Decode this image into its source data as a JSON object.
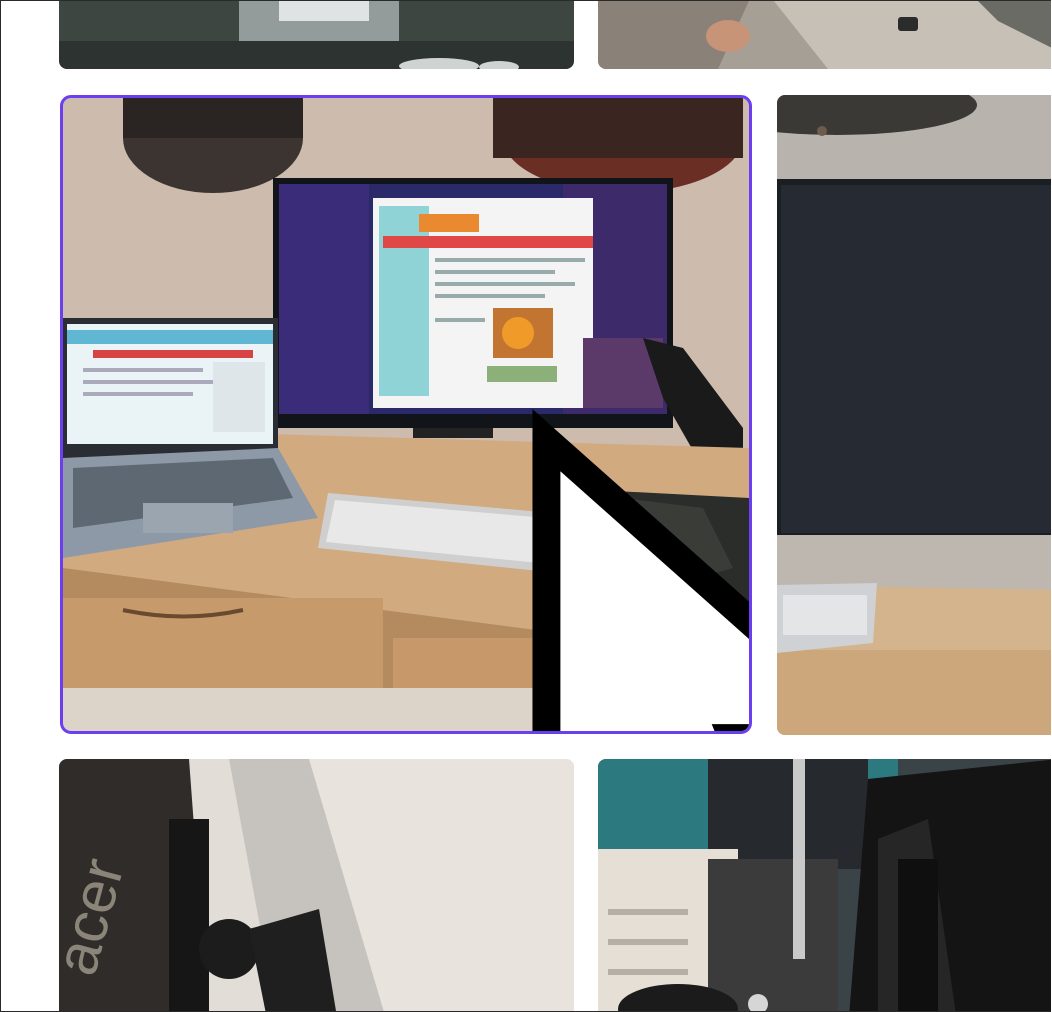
{
  "gallery": {
    "selected_index": 2,
    "items": [
      {
        "id": "photo-1",
        "icon": "photo-thumbnail"
      },
      {
        "id": "photo-2",
        "icon": "photo-thumbnail"
      },
      {
        "id": "photo-3",
        "icon": "photo-thumbnail",
        "selected": true
      },
      {
        "id": "photo-4",
        "icon": "photo-thumbnail"
      },
      {
        "id": "photo-5",
        "icon": "photo-thumbnail"
      },
      {
        "id": "photo-6",
        "icon": "photo-thumbnail"
      }
    ],
    "selection_color": "#6b3ff0"
  },
  "cursor": {
    "icon": "mouse-pointer-icon"
  }
}
